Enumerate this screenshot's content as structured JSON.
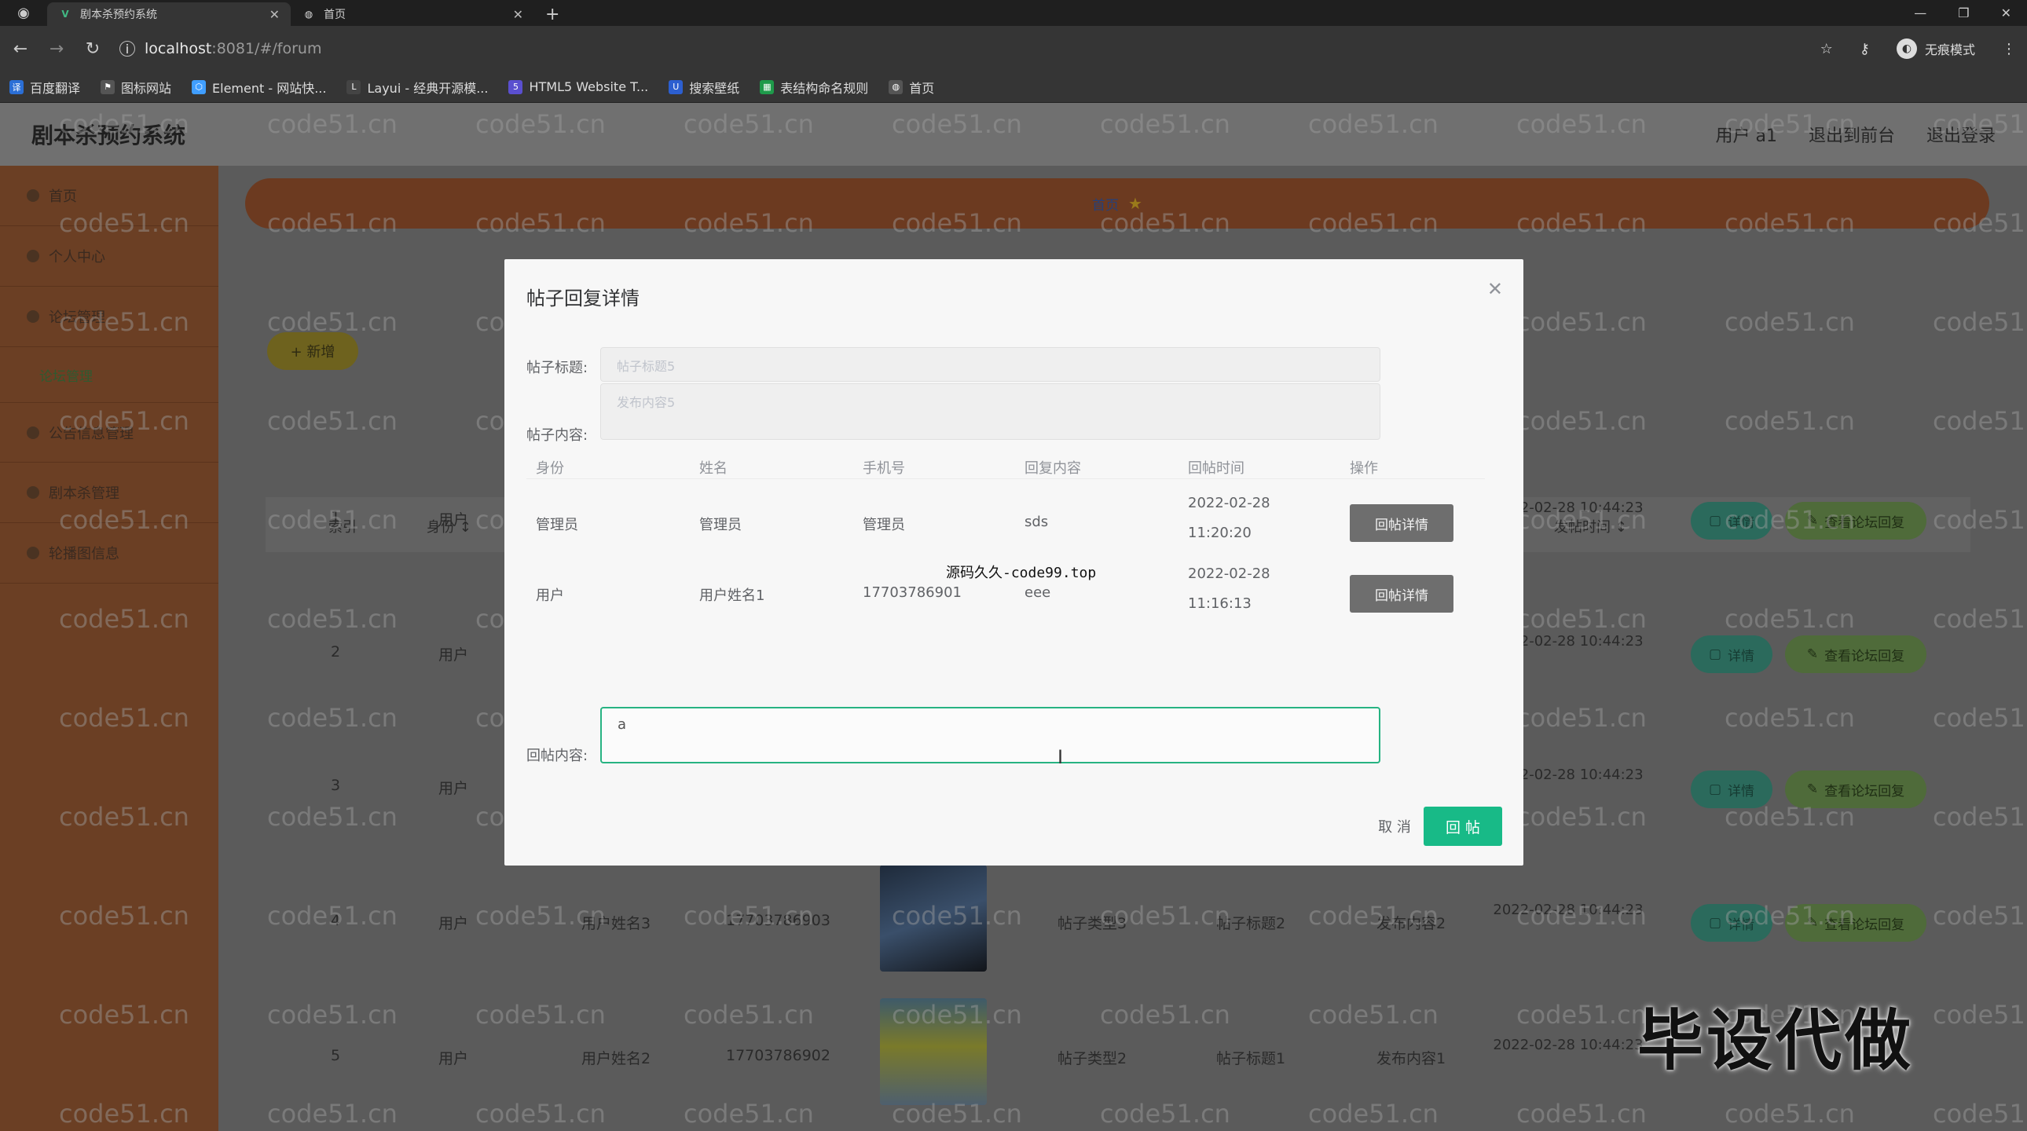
{
  "browser": {
    "tabs": [
      {
        "title": "剧本杀预约系统",
        "active": true,
        "favicon": "V"
      },
      {
        "title": "首页",
        "active": false,
        "favicon": "globe"
      }
    ],
    "url_host": "localhost",
    "url_rest": ":8081/#/forum",
    "incognito_label": "无痕模式",
    "bookmarks": [
      "百度翻译",
      "图标网站",
      "Element - 网站快...",
      "Layui - 经典开源模...",
      "HTML5 Website T...",
      "搜索壁纸",
      "表结构命名规则",
      "首页"
    ]
  },
  "app": {
    "title": "剧本杀预约系统",
    "header_links": [
      "用户 a1",
      "退出到前台",
      "退出登录"
    ],
    "sidebar": {
      "items": [
        "首页",
        "个人中心",
        "论坛管理",
        "论坛管理",
        "公告信息管理",
        "剧本杀管理",
        "轮播图信息"
      ]
    },
    "breadcrumb": [
      "首页"
    ],
    "add_label": "+ 新增",
    "table": {
      "headers": [
        "索引",
        "身份 ↕",
        "发帖时间 ↕",
        "操作"
      ],
      "rows": [
        {
          "index": "1",
          "role": "用户",
          "name": "",
          "phone": "",
          "type": "",
          "title": "",
          "content": "",
          "time": "2022-02-28 10:44:23"
        },
        {
          "index": "2",
          "role": "用户",
          "name": "",
          "phone": "",
          "type": "",
          "title": "",
          "content": "",
          "time": "2022-02-28 10:44:23"
        },
        {
          "index": "3",
          "role": "用户",
          "name": "",
          "phone": "",
          "type": "",
          "title": "",
          "content": "",
          "time": "2022-02-28 10:44:23"
        },
        {
          "index": "4",
          "role": "用户",
          "name": "用户姓名3",
          "phone": "17703786903",
          "type": "帖子类型3",
          "title": "帖子标题2",
          "content": "发布内容2",
          "time": "2022-02-28 10:44:23"
        },
        {
          "index": "5",
          "role": "用户",
          "name": "用户姓名2",
          "phone": "17703786902",
          "type": "帖子类型2",
          "title": "帖子标题1",
          "content": "发布内容1",
          "time": "2022-02-28 10:44:23"
        }
      ],
      "detail_label": "详情",
      "reply_label": "查看论坛回复"
    }
  },
  "modal": {
    "title": "帖子回复详情",
    "title_label": "帖子标题:",
    "title_placeholder": "帖子标题5",
    "content_label": "帖子内容:",
    "content_placeholder": "发布内容5",
    "columns": [
      "身份",
      "姓名",
      "手机号",
      "回复内容",
      "回帖时间",
      "操作"
    ],
    "replies": [
      {
        "role": "管理员",
        "name": "管理员",
        "phone": "管理员",
        "content": "sds",
        "time": "2022-02-28 11:20:20",
        "action": "回帖详情"
      },
      {
        "role": "用户",
        "name": "用户姓名1",
        "phone": "17703786901",
        "content": "eee",
        "time": "2022-02-28 11:16:13",
        "action": "回帖详情"
      }
    ],
    "reply_label": "回帖内容:",
    "reply_value": "a",
    "cancel_label": "取 消",
    "submit_label": "回 帖"
  },
  "overlay_text": "源码久久-code99.top",
  "watermark": "code51.cn",
  "promo_text": "毕设代做",
  "colors": {
    "accent": "#18ba87",
    "sidebar": "#6b3f24"
  }
}
